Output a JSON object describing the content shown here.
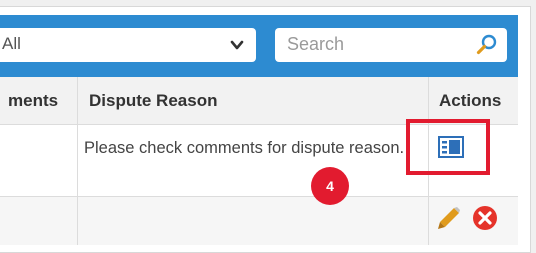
{
  "filter": {
    "selected_value": "All"
  },
  "search": {
    "placeholder": "Search"
  },
  "table": {
    "columns": [
      "ments",
      "Dispute Reason",
      "Actions"
    ],
    "rows": [
      {
        "dispute_reason": "Please check comments for dispute reason."
      }
    ]
  },
  "annotation": {
    "step_number": "4"
  },
  "colors": {
    "toolbar": "#2d8bd1",
    "highlight": "#e21b2f",
    "edit_icon": "#e09b1d",
    "delete_icon": "#e5332a"
  },
  "icons": {
    "chevron": "chevron-down-icon",
    "search": "magnifier-icon",
    "view_details": "details-view-icon",
    "edit": "pencil-icon",
    "delete": "delete-circle-x-icon"
  }
}
